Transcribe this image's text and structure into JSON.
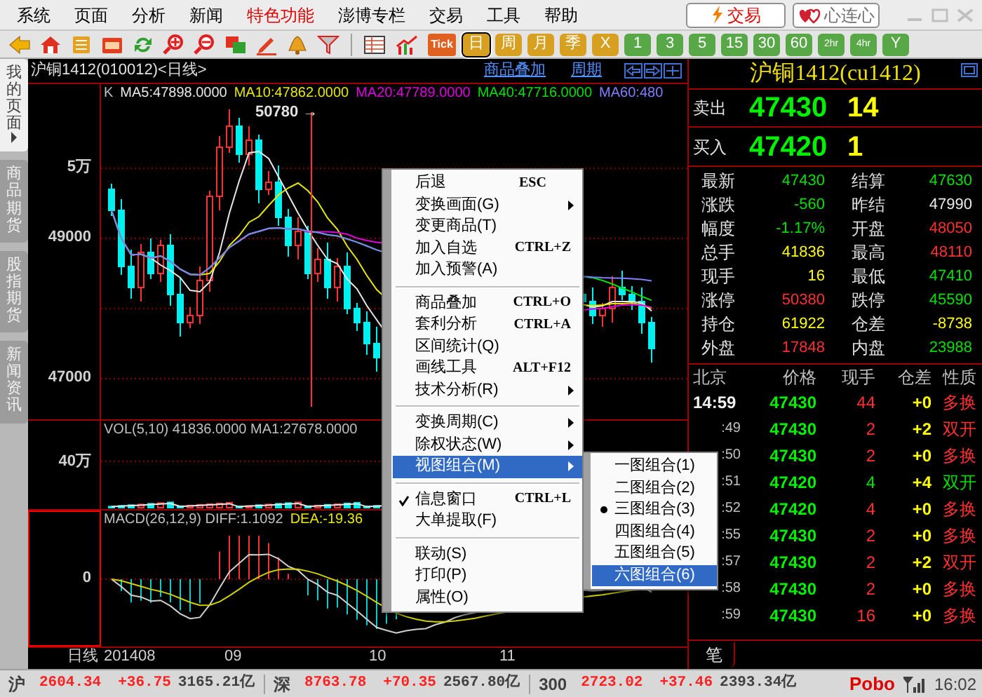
{
  "menu_bar": [
    {
      "label": "系统",
      "highlight": false
    },
    {
      "label": "页面",
      "highlight": false
    },
    {
      "label": "分析",
      "highlight": false
    },
    {
      "label": "新闻",
      "highlight": false
    },
    {
      "label": "特色功能",
      "highlight": true
    },
    {
      "label": "澎博专栏",
      "highlight": false
    },
    {
      "label": "交易",
      "highlight": false
    },
    {
      "label": "工具",
      "highlight": false
    },
    {
      "label": "帮助",
      "highlight": false
    }
  ],
  "top_buttons": [
    {
      "label": "交易",
      "kind": "trade"
    },
    {
      "label": "心连心",
      "kind": "heart"
    }
  ],
  "toolbar": {
    "tick_label": "Tick",
    "periods": [
      {
        "label": "日",
        "kind": "gold",
        "selected": true
      },
      {
        "label": "周",
        "kind": "gold",
        "selected": false
      },
      {
        "label": "月",
        "kind": "gold",
        "selected": false
      },
      {
        "label": "季",
        "kind": "gold",
        "selected": false
      },
      {
        "label": "X",
        "kind": "gold",
        "selected": false
      },
      {
        "label": "1",
        "kind": "green",
        "selected": false
      },
      {
        "label": "3",
        "kind": "green",
        "selected": false
      },
      {
        "label": "5",
        "kind": "green",
        "selected": false
      },
      {
        "label": "15",
        "kind": "green",
        "selected": false
      },
      {
        "label": "30",
        "kind": "green",
        "selected": false
      },
      {
        "label": "60",
        "kind": "green",
        "selected": false
      },
      {
        "label": "2hr",
        "kind": "green",
        "selected": false
      },
      {
        "label": "4hr",
        "kind": "green",
        "selected": false
      },
      {
        "label": "Y",
        "kind": "green",
        "selected": false
      }
    ]
  },
  "sidebar_tabs": [
    {
      "label": "我的页面",
      "selected": true
    },
    {
      "label": "商品期货",
      "selected": false
    },
    {
      "label": "股指期货",
      "selected": false
    },
    {
      "label": "新闻资讯",
      "selected": false
    }
  ],
  "chart": {
    "title": "沪铜1412(010012)<日线>",
    "links": [
      "商品叠加",
      "周期"
    ],
    "main": {
      "legend": [
        {
          "text": "K",
          "color": "#c0c0c0"
        },
        {
          "text": "MA5:47898.0000",
          "color": "#e8e8e8"
        },
        {
          "text": "MA10:47862.0000",
          "color": "#e8e800"
        },
        {
          "text": "MA20:47789.0000",
          "color": "#e000e0"
        },
        {
          "text": "MA40:47716.0000",
          "color": "#00e000"
        },
        {
          "text": "MA60:480",
          "color": "#8080ff"
        }
      ],
      "y_labels": [
        "5万",
        "49000",
        "47000"
      ],
      "peak_label": "50780 →"
    },
    "volume": {
      "legend": [
        {
          "text": "VOL(5,10) 41836.0000 MA1:27678.0000",
          "color": "#c0c0c0"
        }
      ],
      "y_labels": [
        "40万"
      ]
    },
    "macd": {
      "legend": [
        {
          "text": "MACD(26,12,9) DIFF:1.1092",
          "color": "#c0c0c0"
        },
        {
          "text": "DEA:-19.36",
          "color": "#e8e800"
        }
      ],
      "y_labels": [
        "0"
      ]
    },
    "x_axis": [
      "日线",
      "201408",
      "09",
      "10",
      "11"
    ]
  },
  "context_menu": {
    "groups": [
      [
        {
          "label": "后退",
          "shortcut": "ESC",
          "submenu": false,
          "checked": false,
          "selected": false
        },
        {
          "label": "变换画面(G)",
          "submenu": true,
          "checked": false,
          "selected": false
        },
        {
          "label": "变更商品(T)",
          "submenu": false,
          "checked": false,
          "selected": false
        },
        {
          "label": "加入自选",
          "shortcut": "CTRL+Z",
          "submenu": false,
          "checked": false,
          "selected": false
        },
        {
          "label": "加入预警(A)",
          "submenu": false,
          "checked": false,
          "selected": false
        }
      ],
      [
        {
          "label": "商品叠加",
          "shortcut": "CTRL+O",
          "submenu": false,
          "checked": false,
          "selected": false
        },
        {
          "label": "套利分析",
          "shortcut": "CTRL+A",
          "submenu": false,
          "checked": false,
          "selected": false
        },
        {
          "label": "区间统计(Q)",
          "submenu": false,
          "checked": false,
          "selected": false
        },
        {
          "label": "画线工具",
          "shortcut": "ALT+F12",
          "submenu": false,
          "checked": false,
          "selected": false
        },
        {
          "label": "技术分析(R)",
          "submenu": true,
          "checked": false,
          "selected": false
        }
      ],
      [
        {
          "label": "变换周期(C)",
          "submenu": true,
          "checked": false,
          "selected": false
        },
        {
          "label": "除权状态(W)",
          "submenu": true,
          "checked": false,
          "selected": false
        },
        {
          "label": "视图组合(M)",
          "submenu": true,
          "checked": false,
          "selected": true
        }
      ],
      [
        {
          "label": "信息窗口",
          "shortcut": "CTRL+L",
          "submenu": false,
          "checked": true,
          "selected": false
        },
        {
          "label": "大单提取(F)",
          "submenu": false,
          "checked": false,
          "selected": false
        }
      ],
      [
        {
          "label": "联动(S)",
          "submenu": false,
          "checked": false,
          "selected": false
        },
        {
          "label": "打印(P)",
          "submenu": false,
          "checked": false,
          "selected": false
        },
        {
          "label": "属性(O)",
          "submenu": false,
          "checked": false,
          "selected": false
        }
      ]
    ],
    "submenu": [
      {
        "label": "一图组合(1)",
        "checked": false,
        "selected": false
      },
      {
        "label": "二图组合(2)",
        "checked": false,
        "selected": false
      },
      {
        "label": "三图组合(3)",
        "checked": true,
        "selected": false
      },
      {
        "label": "四图组合(4)",
        "checked": false,
        "selected": false
      },
      {
        "label": "五图组合(5)",
        "checked": false,
        "selected": false
      },
      {
        "label": "六图组合(6)",
        "checked": false,
        "selected": true
      }
    ]
  },
  "quote": {
    "title": "沪铜1412(cu1412)",
    "sell": {
      "label": "卖出",
      "price": "47430",
      "volume": "14"
    },
    "buy": {
      "label": "买入",
      "price": "47420",
      "volume": "1"
    },
    "stats": [
      {
        "label": "最新",
        "value": "47430",
        "color": "#00e000"
      },
      {
        "label": "结算",
        "value": "47630",
        "color": "#00e000"
      },
      {
        "label": "涨跌",
        "value": "-560",
        "color": "#00e000"
      },
      {
        "label": "昨结",
        "value": "47990",
        "color": "#e8e8e8"
      },
      {
        "label": "幅度",
        "value": "-1.17%",
        "color": "#00e000"
      },
      {
        "label": "开盘",
        "value": "48050",
        "color": "#ff3030"
      },
      {
        "label": "总手",
        "value": "41836",
        "color": "#ffff00"
      },
      {
        "label": "最高",
        "value": "48110",
        "color": "#ff3030"
      },
      {
        "label": "现手",
        "value": "16",
        "color": "#ffff00"
      },
      {
        "label": "最低",
        "value": "47410",
        "color": "#00e000"
      },
      {
        "label": "涨停",
        "value": "50380",
        "color": "#ff3030"
      },
      {
        "label": "跌停",
        "value": "45590",
        "color": "#00e000"
      },
      {
        "label": "持仓",
        "value": "61922",
        "color": "#ffff00"
      },
      {
        "label": "仓差",
        "value": "-8738",
        "color": "#ffff00"
      },
      {
        "label": "外盘",
        "value": "17848",
        "color": "#ff3030"
      },
      {
        "label": "内盘",
        "value": "23988",
        "color": "#00e000"
      }
    ]
  },
  "ticks": {
    "columns": [
      "北京",
      "价格",
      "现手",
      "仓差",
      "性质"
    ],
    "rows": [
      {
        "time": "14:59",
        "price": "47430",
        "volume": {
          "text": "44",
          "color": "#ff3030"
        },
        "change": "+0",
        "nature": {
          "text": "多换",
          "color": "#ff3030"
        }
      },
      {
        "time": ":49",
        "price": "47430",
        "volume": {
          "text": "2",
          "color": "#ff3030"
        },
        "change": "+2",
        "nature": {
          "text": "双开",
          "color": "#ff3030"
        }
      },
      {
        "time": ":50",
        "price": "47430",
        "volume": {
          "text": "2",
          "color": "#ff3030"
        },
        "change": "+0",
        "nature": {
          "text": "多换",
          "color": "#ff3030"
        }
      },
      {
        "time": ":51",
        "price": "47420",
        "volume": {
          "text": "4",
          "color": "#00e000"
        },
        "change": "+4",
        "nature": {
          "text": "双开",
          "color": "#00e000"
        }
      },
      {
        "time": ":52",
        "price": "47420",
        "volume": {
          "text": "4",
          "color": "#ff3030"
        },
        "change": "+0",
        "nature": {
          "text": "多换",
          "color": "#ff3030"
        }
      },
      {
        "time": ":55",
        "price": "47430",
        "volume": {
          "text": "2",
          "color": "#ff3030"
        },
        "change": "+0",
        "nature": {
          "text": "多换",
          "color": "#ff3030"
        }
      },
      {
        "time": ":57",
        "price": "47430",
        "volume": {
          "text": "2",
          "color": "#ff3030"
        },
        "change": "+2",
        "nature": {
          "text": "双开",
          "color": "#ff3030"
        }
      },
      {
        "time": ":58",
        "price": "47430",
        "volume": {
          "text": "2",
          "color": "#ff3030"
        },
        "change": "+0",
        "nature": {
          "text": "多换",
          "color": "#ff3030"
        }
      },
      {
        "time": ":59",
        "price": "47430",
        "volume": {
          "text": "16",
          "color": "#ff3030"
        },
        "change": "+0",
        "nature": {
          "text": "多换",
          "color": "#ff3030"
        }
      }
    ],
    "tab": "笔"
  },
  "status_bar": {
    "indices": [
      {
        "name": "沪",
        "value": "2604.34",
        "change": "+36.75",
        "turnover": "3165.21亿"
      },
      {
        "name": "深",
        "value": "8763.78",
        "change": "+70.35",
        "turnover": "2567.80亿"
      },
      {
        "name": "300",
        "value": "2723.02",
        "change": "+37.46",
        "turnover": "2393.34亿"
      }
    ],
    "brand": "Pobo",
    "time": "16:02"
  }
}
